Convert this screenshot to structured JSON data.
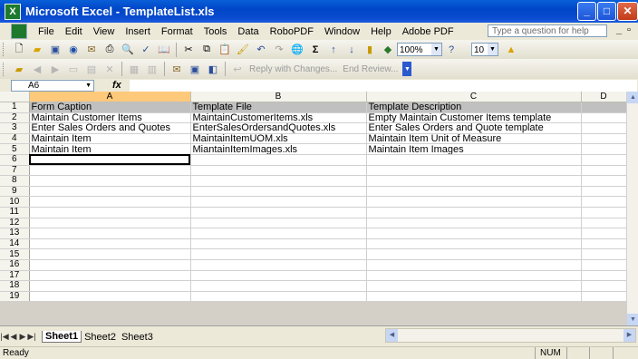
{
  "window": {
    "title": "Microsoft Excel - TemplateList.xls"
  },
  "menu": {
    "items": [
      "File",
      "Edit",
      "View",
      "Insert",
      "Format",
      "Tools",
      "Data",
      "RoboPDF",
      "Window",
      "Help",
      "Adobe PDF"
    ],
    "help_placeholder": "Type a question for help"
  },
  "toolbar1": {
    "zoom": "100%",
    "font_size": "10"
  },
  "toolbar2": {
    "reply_text": "Reply with Changes...",
    "end_review": "End Review..."
  },
  "formula_bar": {
    "name_box": "A6",
    "fx": "fx",
    "formula": ""
  },
  "columns": [
    "A",
    "B",
    "C",
    "D"
  ],
  "rows": [
    {
      "n": "1",
      "a": "Form Caption",
      "b": "Template File",
      "c": "Template Description",
      "d": ""
    },
    {
      "n": "2",
      "a": "Maintain Customer Items",
      "b": "MaintainCustomerItems.xls",
      "c": "Empty Maintain Customer Items template",
      "d": ""
    },
    {
      "n": "3",
      "a": "Enter Sales Orders and Quotes",
      "b": "EnterSalesOrdersandQuotes.xls",
      "c": "Enter Sales Orders and Quote template",
      "d": ""
    },
    {
      "n": "4",
      "a": "Maintain Item",
      "b": "MaintainItemUOM.xls",
      "c": "Maintain Item Unit of Measure",
      "d": ""
    },
    {
      "n": "5",
      "a": "Maintain Item",
      "b": "MiantainItemImages.xls",
      "c": "Maintain Item Images",
      "d": ""
    },
    {
      "n": "6",
      "a": "",
      "b": "",
      "c": "",
      "d": ""
    },
    {
      "n": "7",
      "a": "",
      "b": "",
      "c": "",
      "d": ""
    },
    {
      "n": "8",
      "a": "",
      "b": "",
      "c": "",
      "d": ""
    },
    {
      "n": "9",
      "a": "",
      "b": "",
      "c": "",
      "d": ""
    },
    {
      "n": "10",
      "a": "",
      "b": "",
      "c": "",
      "d": ""
    },
    {
      "n": "11",
      "a": "",
      "b": "",
      "c": "",
      "d": ""
    },
    {
      "n": "12",
      "a": "",
      "b": "",
      "c": "",
      "d": ""
    },
    {
      "n": "13",
      "a": "",
      "b": "",
      "c": "",
      "d": ""
    },
    {
      "n": "14",
      "a": "",
      "b": "",
      "c": "",
      "d": ""
    },
    {
      "n": "15",
      "a": "",
      "b": "",
      "c": "",
      "d": ""
    },
    {
      "n": "16",
      "a": "",
      "b": "",
      "c": "",
      "d": ""
    },
    {
      "n": "17",
      "a": "",
      "b": "",
      "c": "",
      "d": ""
    },
    {
      "n": "18",
      "a": "",
      "b": "",
      "c": "",
      "d": ""
    },
    {
      "n": "19",
      "a": "",
      "b": "",
      "c": "",
      "d": ""
    }
  ],
  "sheets": [
    "Sheet1",
    "Sheet2",
    "Sheet3"
  ],
  "status": {
    "left": "Ready",
    "num": "NUM"
  },
  "colors": {
    "title_blue": "#0a5fd8",
    "header_row_gray": "#c0c0c0",
    "active_header": "#ffc97b"
  }
}
